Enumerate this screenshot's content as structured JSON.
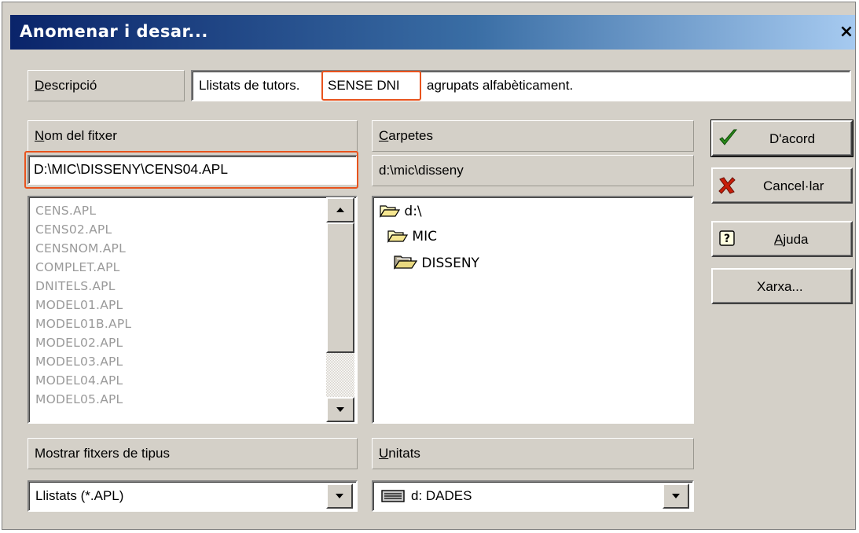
{
  "window": {
    "title": "Anomenar i desar...",
    "close_glyph": "×"
  },
  "description": {
    "label_underlined": "D",
    "label_rest": "escripció",
    "value_before": "Llistats de tutors.",
    "value_highlight": "SENSE DNI",
    "value_after": "agrupats alfabèticament."
  },
  "filename": {
    "label_underlined": "N",
    "label_rest": "om del fitxer",
    "value": "D:\\MIC\\DISSENY\\CENS04.APL"
  },
  "files": [
    "CENS.APL",
    "CENS02.APL",
    "CENSNOM.APL",
    "COMPLET.APL",
    "DNITELS.APL",
    "MODEL01.APL",
    "MODEL01B.APL",
    "MODEL02.APL",
    "MODEL03.APL",
    "MODEL04.APL",
    "MODEL05.APL"
  ],
  "folders": {
    "label_underlined": "C",
    "label_rest": "arpetes",
    "current_path": "d:\\mic\\disseny",
    "tree": [
      "d:\\",
      "MIC",
      "DISSENY"
    ]
  },
  "filetype": {
    "label": "Mostrar fitxers de tipus",
    "selected": "Llistats (*.APL)"
  },
  "drives": {
    "label_underlined": "U",
    "label_rest": "nitats",
    "selected": "d: DADES"
  },
  "buttons": {
    "ok": "D'acord",
    "cancel": "Cancel·lar",
    "help_underlined": "A",
    "help_rest": "juda",
    "network": "Xarxa..."
  },
  "colors": {
    "highlight_border": "#e8531d",
    "title_bar_start": "#0a246a",
    "dialog_face": "#d4d0c8",
    "ok_check": "#2a8a1a",
    "cancel_x": "#c81e0a"
  },
  "icons": {
    "ok": "check-icon",
    "cancel": "red-x-icon",
    "help": "question-icon",
    "folder_open": "open-folder-icon",
    "drive": "hard-drive-icon"
  }
}
